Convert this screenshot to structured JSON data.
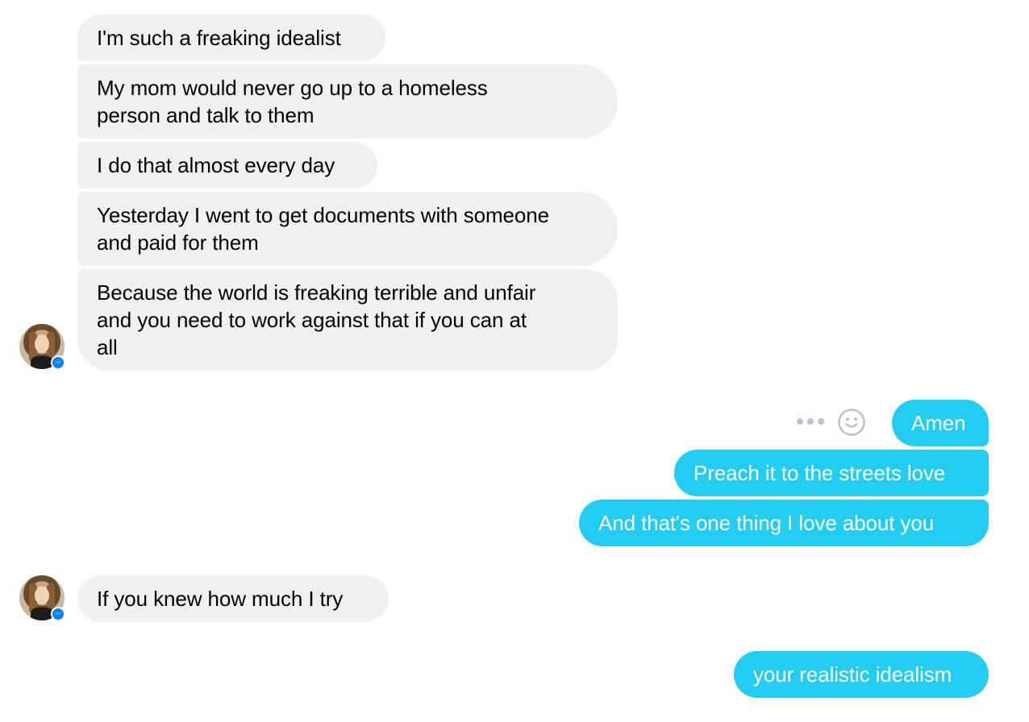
{
  "conversation": {
    "group1": {
      "messages": [
        "I'm such a freaking idealist",
        [
          "My mom would never go up to a homeless",
          "person and talk to them"
        ],
        "I do that almost every day",
        [
          "Yesterday I went to get documents with someone",
          "and paid for them"
        ],
        [
          "Because the world is freaking terrible and unfair",
          "and you need to work against that if you can at",
          "all"
        ]
      ]
    },
    "group2": {
      "messages": [
        "Amen",
        "Preach it to the streets love",
        "And that's one thing I love about you"
      ]
    },
    "group3": {
      "messages": [
        "If you knew how much I try"
      ]
    },
    "group4": {
      "messages": [
        "your realistic idealism"
      ]
    }
  },
  "icons": {
    "avatar": "contact-avatar",
    "badge": "messenger-badge-icon",
    "more": "more-options-icon",
    "react": "smiley-reaction-icon"
  },
  "colors": {
    "incoming_bubble": "#f1f0f0",
    "outgoing_bubble": "#23ccf1",
    "outgoing_text": "#ffffff",
    "badge": "#0084ff",
    "icon_gray": "#bec2c9"
  }
}
